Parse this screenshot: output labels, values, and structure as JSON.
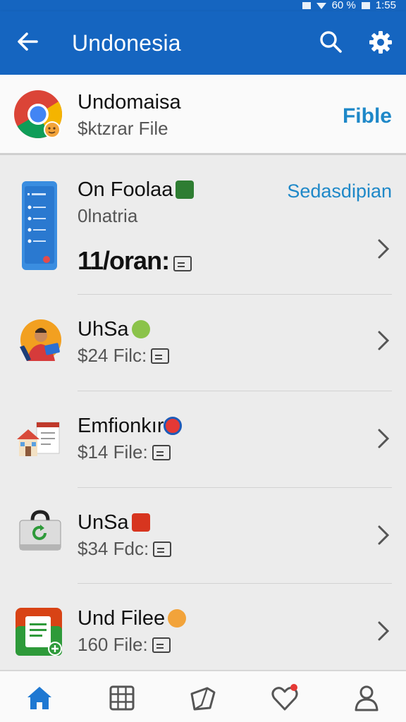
{
  "status_bar": {
    "battery_text": "60 %",
    "time": "1:55"
  },
  "app_bar": {
    "title": "Undonesia",
    "back_icon": "arrow-left-icon",
    "search_icon": "search-icon",
    "settings_icon": "gear-icon"
  },
  "header_card": {
    "name": "Undomaisa",
    "sub": "$ktzrar File",
    "action": "Fible",
    "logo": "chrome-logo"
  },
  "rows": [
    {
      "name": "On Foolaa",
      "sub": "0lnatria",
      "extra": "11/oran:",
      "action": "Sedasdipian",
      "icon": "phone-app-icon"
    },
    {
      "name": "UhSa",
      "sub": "$24 Filc:",
      "icon": "person-tablet-icon"
    },
    {
      "name": "Emfionkır",
      "sub": "$14 File:",
      "icon": "house-icon"
    },
    {
      "name": "UnSa",
      "sub": "$34 Fdc:",
      "icon": "refresh-bag-icon"
    },
    {
      "name": "Und Filee",
      "sub": "160 File:",
      "icon": "document-add-icon"
    }
  ],
  "bottom_nav": [
    "home-icon",
    "grid-icon",
    "tag-icon",
    "heart-icon",
    "profile-icon"
  ],
  "colors": {
    "primary": "#1565c0",
    "accent": "#1e88c8"
  }
}
